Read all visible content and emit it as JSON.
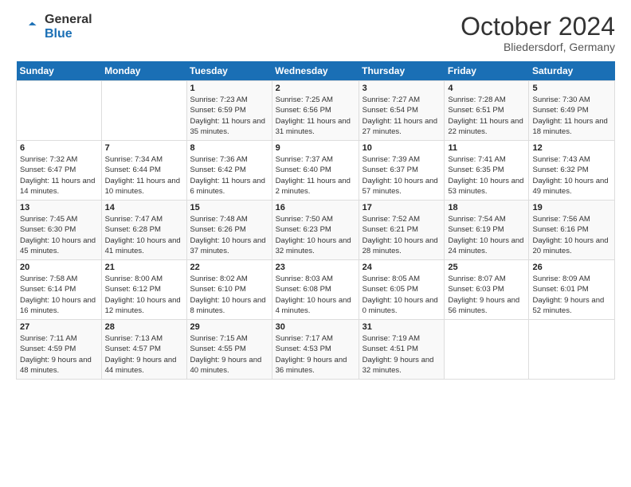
{
  "header": {
    "logo_line1": "General",
    "logo_line2": "Blue",
    "month": "October 2024",
    "location": "Bliedersdorf, Germany"
  },
  "days_of_week": [
    "Sunday",
    "Monday",
    "Tuesday",
    "Wednesday",
    "Thursday",
    "Friday",
    "Saturday"
  ],
  "weeks": [
    [
      {
        "day": "",
        "sunrise": "",
        "sunset": "",
        "daylight": ""
      },
      {
        "day": "",
        "sunrise": "",
        "sunset": "",
        "daylight": ""
      },
      {
        "day": "1",
        "sunrise": "Sunrise: 7:23 AM",
        "sunset": "Sunset: 6:59 PM",
        "daylight": "Daylight: 11 hours and 35 minutes."
      },
      {
        "day": "2",
        "sunrise": "Sunrise: 7:25 AM",
        "sunset": "Sunset: 6:56 PM",
        "daylight": "Daylight: 11 hours and 31 minutes."
      },
      {
        "day": "3",
        "sunrise": "Sunrise: 7:27 AM",
        "sunset": "Sunset: 6:54 PM",
        "daylight": "Daylight: 11 hours and 27 minutes."
      },
      {
        "day": "4",
        "sunrise": "Sunrise: 7:28 AM",
        "sunset": "Sunset: 6:51 PM",
        "daylight": "Daylight: 11 hours and 22 minutes."
      },
      {
        "day": "5",
        "sunrise": "Sunrise: 7:30 AM",
        "sunset": "Sunset: 6:49 PM",
        "daylight": "Daylight: 11 hours and 18 minutes."
      }
    ],
    [
      {
        "day": "6",
        "sunrise": "Sunrise: 7:32 AM",
        "sunset": "Sunset: 6:47 PM",
        "daylight": "Daylight: 11 hours and 14 minutes."
      },
      {
        "day": "7",
        "sunrise": "Sunrise: 7:34 AM",
        "sunset": "Sunset: 6:44 PM",
        "daylight": "Daylight: 11 hours and 10 minutes."
      },
      {
        "day": "8",
        "sunrise": "Sunrise: 7:36 AM",
        "sunset": "Sunset: 6:42 PM",
        "daylight": "Daylight: 11 hours and 6 minutes."
      },
      {
        "day": "9",
        "sunrise": "Sunrise: 7:37 AM",
        "sunset": "Sunset: 6:40 PM",
        "daylight": "Daylight: 11 hours and 2 minutes."
      },
      {
        "day": "10",
        "sunrise": "Sunrise: 7:39 AM",
        "sunset": "Sunset: 6:37 PM",
        "daylight": "Daylight: 10 hours and 57 minutes."
      },
      {
        "day": "11",
        "sunrise": "Sunrise: 7:41 AM",
        "sunset": "Sunset: 6:35 PM",
        "daylight": "Daylight: 10 hours and 53 minutes."
      },
      {
        "day": "12",
        "sunrise": "Sunrise: 7:43 AM",
        "sunset": "Sunset: 6:32 PM",
        "daylight": "Daylight: 10 hours and 49 minutes."
      }
    ],
    [
      {
        "day": "13",
        "sunrise": "Sunrise: 7:45 AM",
        "sunset": "Sunset: 6:30 PM",
        "daylight": "Daylight: 10 hours and 45 minutes."
      },
      {
        "day": "14",
        "sunrise": "Sunrise: 7:47 AM",
        "sunset": "Sunset: 6:28 PM",
        "daylight": "Daylight: 10 hours and 41 minutes."
      },
      {
        "day": "15",
        "sunrise": "Sunrise: 7:48 AM",
        "sunset": "Sunset: 6:26 PM",
        "daylight": "Daylight: 10 hours and 37 minutes."
      },
      {
        "day": "16",
        "sunrise": "Sunrise: 7:50 AM",
        "sunset": "Sunset: 6:23 PM",
        "daylight": "Daylight: 10 hours and 32 minutes."
      },
      {
        "day": "17",
        "sunrise": "Sunrise: 7:52 AM",
        "sunset": "Sunset: 6:21 PM",
        "daylight": "Daylight: 10 hours and 28 minutes."
      },
      {
        "day": "18",
        "sunrise": "Sunrise: 7:54 AM",
        "sunset": "Sunset: 6:19 PM",
        "daylight": "Daylight: 10 hours and 24 minutes."
      },
      {
        "day": "19",
        "sunrise": "Sunrise: 7:56 AM",
        "sunset": "Sunset: 6:16 PM",
        "daylight": "Daylight: 10 hours and 20 minutes."
      }
    ],
    [
      {
        "day": "20",
        "sunrise": "Sunrise: 7:58 AM",
        "sunset": "Sunset: 6:14 PM",
        "daylight": "Daylight: 10 hours and 16 minutes."
      },
      {
        "day": "21",
        "sunrise": "Sunrise: 8:00 AM",
        "sunset": "Sunset: 6:12 PM",
        "daylight": "Daylight: 10 hours and 12 minutes."
      },
      {
        "day": "22",
        "sunrise": "Sunrise: 8:02 AM",
        "sunset": "Sunset: 6:10 PM",
        "daylight": "Daylight: 10 hours and 8 minutes."
      },
      {
        "day": "23",
        "sunrise": "Sunrise: 8:03 AM",
        "sunset": "Sunset: 6:08 PM",
        "daylight": "Daylight: 10 hours and 4 minutes."
      },
      {
        "day": "24",
        "sunrise": "Sunrise: 8:05 AM",
        "sunset": "Sunset: 6:05 PM",
        "daylight": "Daylight: 10 hours and 0 minutes."
      },
      {
        "day": "25",
        "sunrise": "Sunrise: 8:07 AM",
        "sunset": "Sunset: 6:03 PM",
        "daylight": "Daylight: 9 hours and 56 minutes."
      },
      {
        "day": "26",
        "sunrise": "Sunrise: 8:09 AM",
        "sunset": "Sunset: 6:01 PM",
        "daylight": "Daylight: 9 hours and 52 minutes."
      }
    ],
    [
      {
        "day": "27",
        "sunrise": "Sunrise: 7:11 AM",
        "sunset": "Sunset: 4:59 PM",
        "daylight": "Daylight: 9 hours and 48 minutes."
      },
      {
        "day": "28",
        "sunrise": "Sunrise: 7:13 AM",
        "sunset": "Sunset: 4:57 PM",
        "daylight": "Daylight: 9 hours and 44 minutes."
      },
      {
        "day": "29",
        "sunrise": "Sunrise: 7:15 AM",
        "sunset": "Sunset: 4:55 PM",
        "daylight": "Daylight: 9 hours and 40 minutes."
      },
      {
        "day": "30",
        "sunrise": "Sunrise: 7:17 AM",
        "sunset": "Sunset: 4:53 PM",
        "daylight": "Daylight: 9 hours and 36 minutes."
      },
      {
        "day": "31",
        "sunrise": "Sunrise: 7:19 AM",
        "sunset": "Sunset: 4:51 PM",
        "daylight": "Daylight: 9 hours and 32 minutes."
      },
      {
        "day": "",
        "sunrise": "",
        "sunset": "",
        "daylight": ""
      },
      {
        "day": "",
        "sunrise": "",
        "sunset": "",
        "daylight": ""
      }
    ]
  ]
}
